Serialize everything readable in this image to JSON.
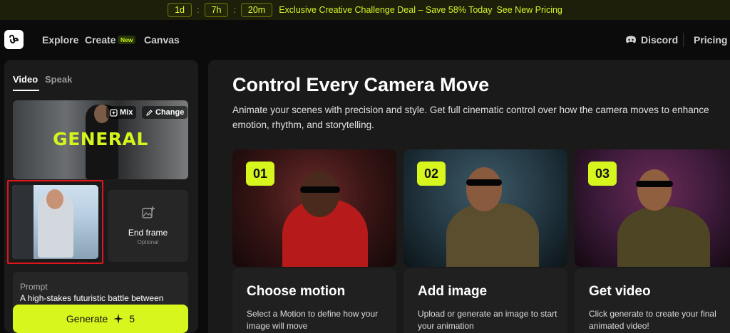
{
  "promo": {
    "days": "1d",
    "hours": "7h",
    "minutes": "20m",
    "separator": ":",
    "message": "Exclusive Creative Challenge Deal – Save 58% Today",
    "link": "See New Pricing"
  },
  "nav": {
    "explore": "Explore",
    "create": "Create",
    "create_badge": "New",
    "canvas": "Canvas",
    "discord": "Discord",
    "pricing": "Pricing"
  },
  "sidebar": {
    "tabs": [
      {
        "label": "Video"
      },
      {
        "label": "Speak"
      }
    ],
    "general_card": {
      "title": "GENERAL",
      "mix_label": "Mix",
      "change_label": "Change"
    },
    "end_frame": {
      "title": "End frame",
      "subtitle": "Optional"
    },
    "prompt": {
      "label": "Prompt",
      "text": "A high-stakes futuristic battle between"
    },
    "generate": {
      "label": "Generate",
      "cost": "5"
    }
  },
  "main": {
    "title": "Control Every Camera Move",
    "description": "Animate your scenes with precision and style. Get full cinematic control over how the camera moves to enhance emotion, rhythm, and storytelling.",
    "steps": [
      {
        "number": "01",
        "title": "Choose motion",
        "desc": "Select a Motion to define how your image will move"
      },
      {
        "number": "02",
        "title": "Add image",
        "desc": "Upload or generate an image to start your animation"
      },
      {
        "number": "03",
        "title": "Get video",
        "desc": "Click generate to create your final animated video!"
      }
    ]
  },
  "colors": {
    "accent": "#d7f61d",
    "background": "#0b0b0b",
    "panel": "#1b1b1b",
    "highlight_border": "#e2141e"
  },
  "icons": [
    "logo-icon",
    "discord-icon",
    "mix-icon",
    "pencil-icon",
    "image-plus-icon",
    "sparkle-icon"
  ]
}
